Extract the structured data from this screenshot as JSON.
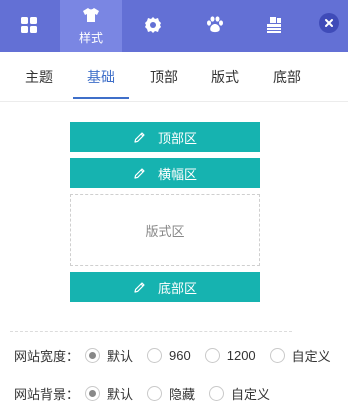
{
  "toolbar": {
    "tabs": [
      {
        "icon": "grid-icon",
        "label": ""
      },
      {
        "icon": "tshirt-icon",
        "label": "样式"
      },
      {
        "icon": "gear-icon",
        "label": ""
      },
      {
        "icon": "paw-icon",
        "label": ""
      },
      {
        "icon": "stamp-icon",
        "label": ""
      }
    ],
    "active_index": 1,
    "close_icon": "close-icon"
  },
  "subtabs": {
    "items": [
      "主题",
      "基础",
      "顶部",
      "版式",
      "底部"
    ],
    "active_index": 1
  },
  "layout": {
    "top_zone": "顶部区",
    "banner_zone": "横幅区",
    "layout_zone": "版式区",
    "bottom_zone": "底部区"
  },
  "settings": {
    "width": {
      "label": "网站宽度：",
      "options": [
        "默认",
        "960",
        "1200",
        "自定义"
      ],
      "selected": "默认"
    },
    "background": {
      "label": "网站背景：",
      "options": [
        "默认",
        "隐藏",
        "自定义"
      ],
      "selected": "默认"
    }
  },
  "colors": {
    "header_bg": "#6370d5",
    "accent": "#3f6fc9",
    "block_bg": "#16b3b0"
  }
}
